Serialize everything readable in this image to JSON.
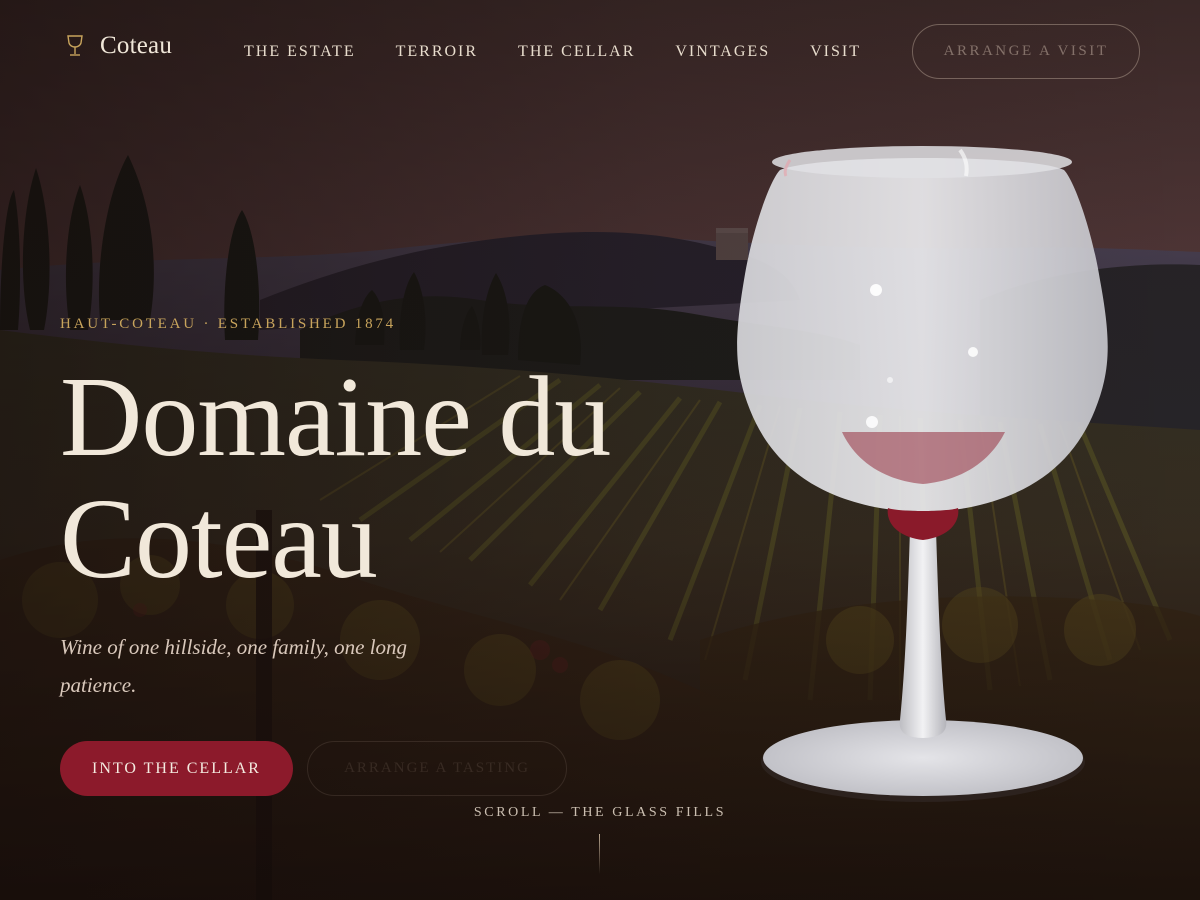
{
  "brand": {
    "name": "Coteau",
    "icon": "wine-glass-icon"
  },
  "nav": {
    "links": [
      "THE ESTATE",
      "TERROIR",
      "THE CELLAR",
      "VINTAGES",
      "VISIT"
    ],
    "cta_label": "ARRANGE A VISIT"
  },
  "hero": {
    "eyebrow": "HAUT-COTEAU · ESTABLISHED 1874",
    "headline_line1": "Domaine du",
    "headline_line2": "Coteau",
    "tagline": "Wine of one hillside, one family, one long patience.",
    "primary_button": "INTO THE CELLAR",
    "secondary_button": "ARRANGE A TASTING",
    "scroll_hint": "SCROLL — THE GLASS FILLS"
  },
  "glass": {
    "fill_fraction": 0.12,
    "wine_color": "#8a1a2a"
  },
  "colors": {
    "accent_gold": "#c8a45c",
    "button_burgundy": "#8c1a2b",
    "text_cream": "#f1e8da"
  }
}
